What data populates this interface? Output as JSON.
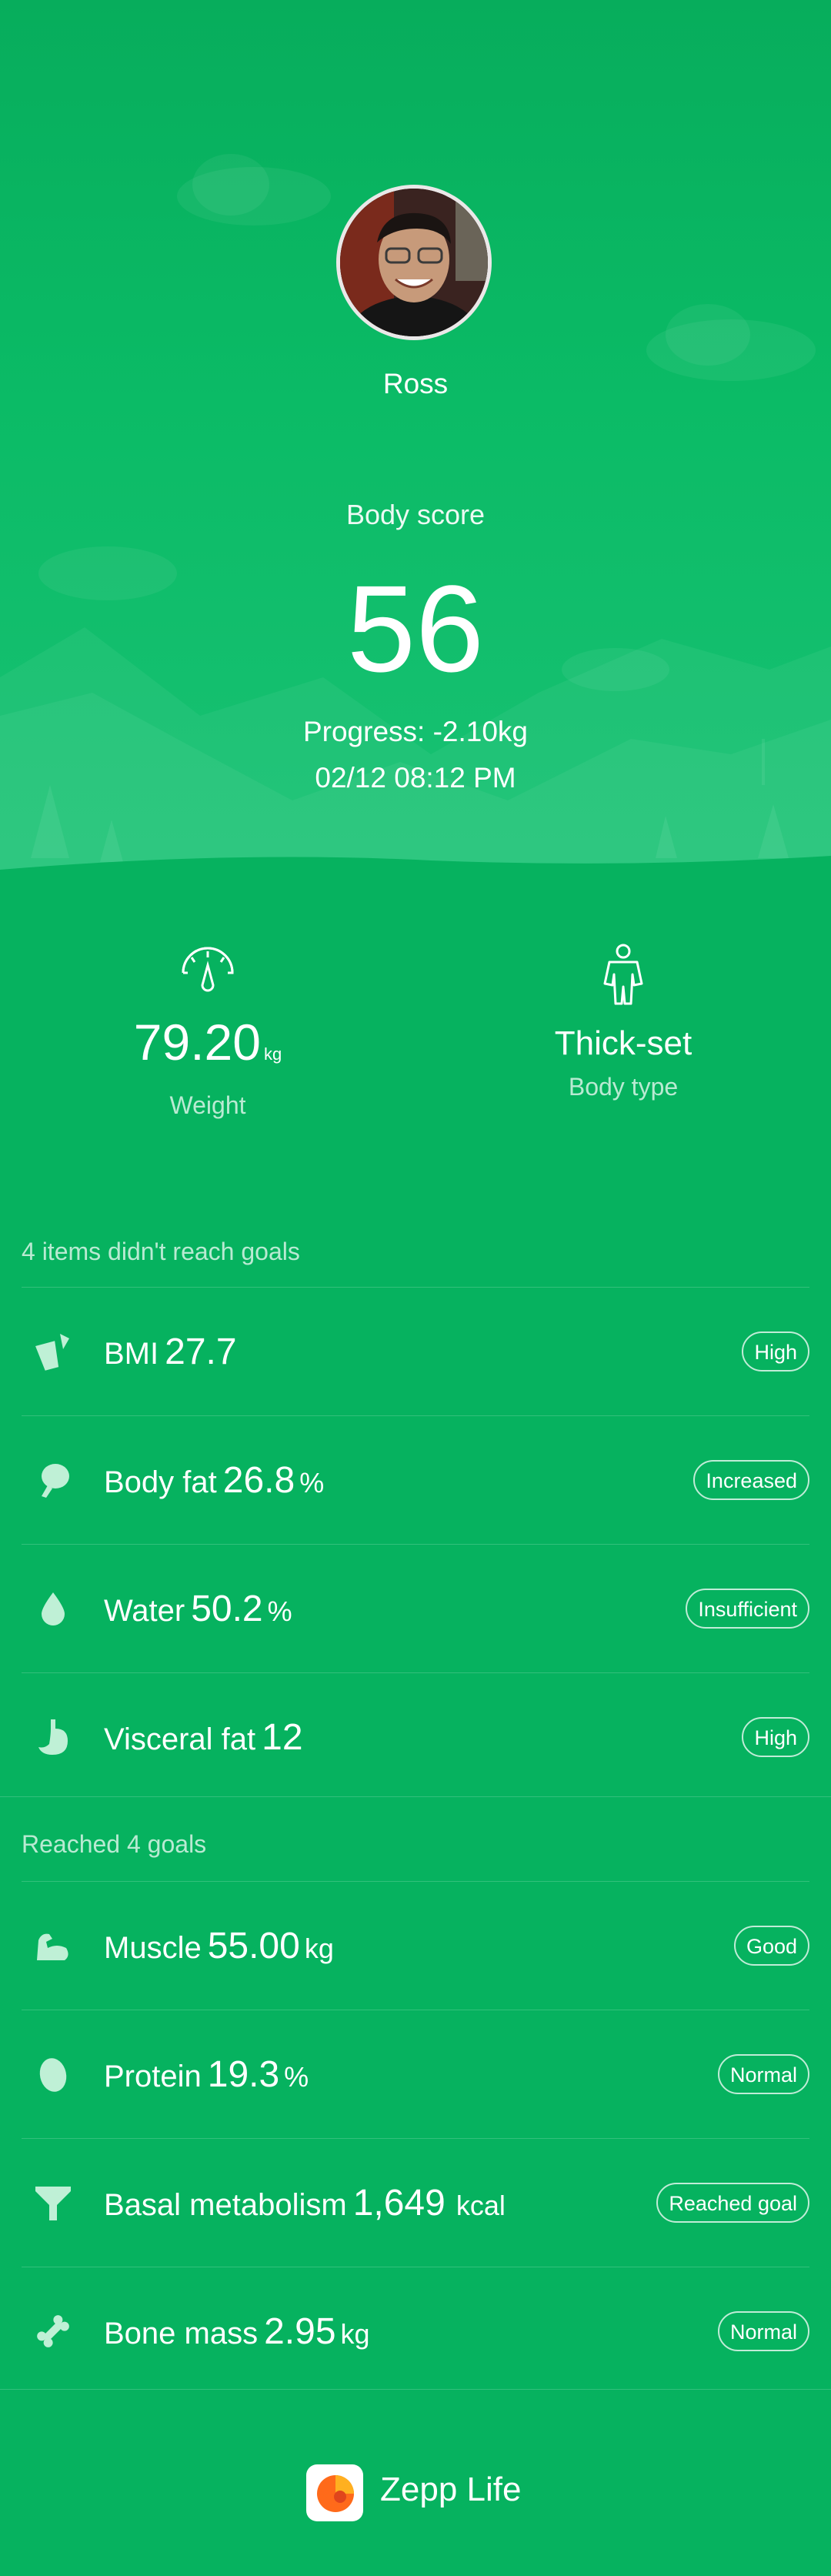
{
  "profile": {
    "name": "Ross"
  },
  "score": {
    "label": "Body score",
    "value": "56",
    "progress": "Progress: -2.10kg",
    "timestamp": "02/12 08:12 PM"
  },
  "summary": {
    "weight": {
      "value": "79.20",
      "unit": "kg",
      "label": "Weight",
      "icon": "scale-icon"
    },
    "body_type": {
      "value": "Thick-set",
      "label": "Body type",
      "icon": "person-icon"
    }
  },
  "unmet": {
    "title": "4 items didn't reach goals",
    "items": [
      {
        "name": "BMI",
        "value": "27.7",
        "unit": "",
        "status": "High",
        "icon": "bmi-icon"
      },
      {
        "name": "Body fat",
        "value": "26.8",
        "unit": "%",
        "status": "Increased",
        "icon": "body-fat-icon"
      },
      {
        "name": "Water",
        "value": "50.2",
        "unit": "%",
        "status": "Insufficient",
        "icon": "water-drop-icon"
      },
      {
        "name": "Visceral fat",
        "value": "12",
        "unit": "",
        "status": "High",
        "icon": "stomach-icon"
      }
    ]
  },
  "met": {
    "title": "Reached 4 goals",
    "items": [
      {
        "name": "Muscle",
        "value": "55.00",
        "unit": "kg",
        "status": "Good",
        "icon": "muscle-icon"
      },
      {
        "name": "Protein",
        "value": "19.3",
        "unit": "%",
        "status": "Normal",
        "icon": "protein-icon"
      },
      {
        "name": "Basal metabolism",
        "value": "1,649",
        "unit": "kcal",
        "status": "Reached goal",
        "icon": "funnel-icon"
      },
      {
        "name": "Bone mass",
        "value": "2.95",
        "unit": "kg",
        "status": "Normal",
        "icon": "bone-icon"
      }
    ]
  },
  "footer": {
    "app_name": "Zepp Life",
    "logo_icon": "zepp-life-logo"
  },
  "colors": {
    "background": "#06b25f",
    "text": "#ffffff",
    "logo_orange": "#ff6a1a"
  }
}
